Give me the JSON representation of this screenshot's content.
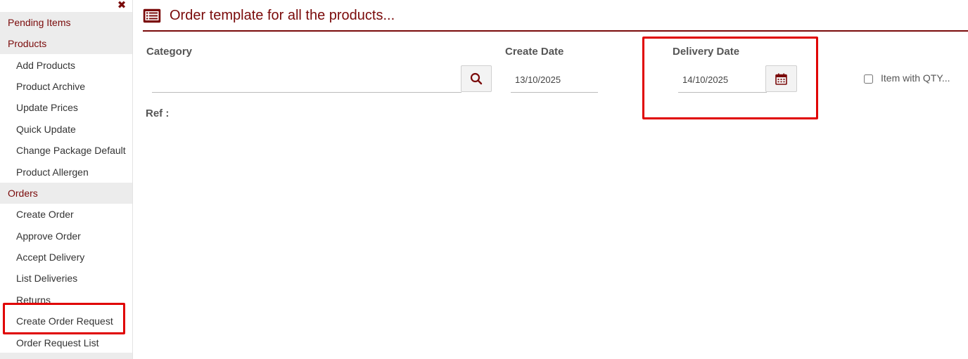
{
  "sidebar": {
    "sections": [
      {
        "label": "Pending Items"
      },
      {
        "label": "Products"
      },
      {
        "label": "Orders"
      }
    ],
    "products_items": [
      {
        "label": "Add Products"
      },
      {
        "label": "Product Archive"
      },
      {
        "label": "Update Prices"
      },
      {
        "label": "Quick Update"
      },
      {
        "label": "Change Package Default"
      },
      {
        "label": "Product Allergen"
      }
    ],
    "orders_items": [
      {
        "label": "Create Order"
      },
      {
        "label": "Approve Order"
      },
      {
        "label": "Accept Delivery"
      },
      {
        "label": "List Deliveries"
      },
      {
        "label": "Returns"
      },
      {
        "label": "Create Order Request"
      },
      {
        "label": "Order Request List"
      }
    ],
    "close_glyph": "✖"
  },
  "page": {
    "title": "Order template for all the products..."
  },
  "form": {
    "category_label": "Category",
    "category_value": "",
    "create_date_label": "Create Date",
    "create_date_value": "13/10/2025",
    "delivery_date_label": "Delivery Date",
    "delivery_date_value": "14/10/2025",
    "item_with_qty_label": "Item with QTY...",
    "item_with_qty_checked": false,
    "ref_label": "Ref :"
  },
  "colors": {
    "brand": "#7a0a0a",
    "highlight": "#e00000"
  },
  "icons": {
    "menu": "list-icon",
    "search": "search-icon",
    "calendar": "calendar-icon",
    "close": "close-icon"
  }
}
